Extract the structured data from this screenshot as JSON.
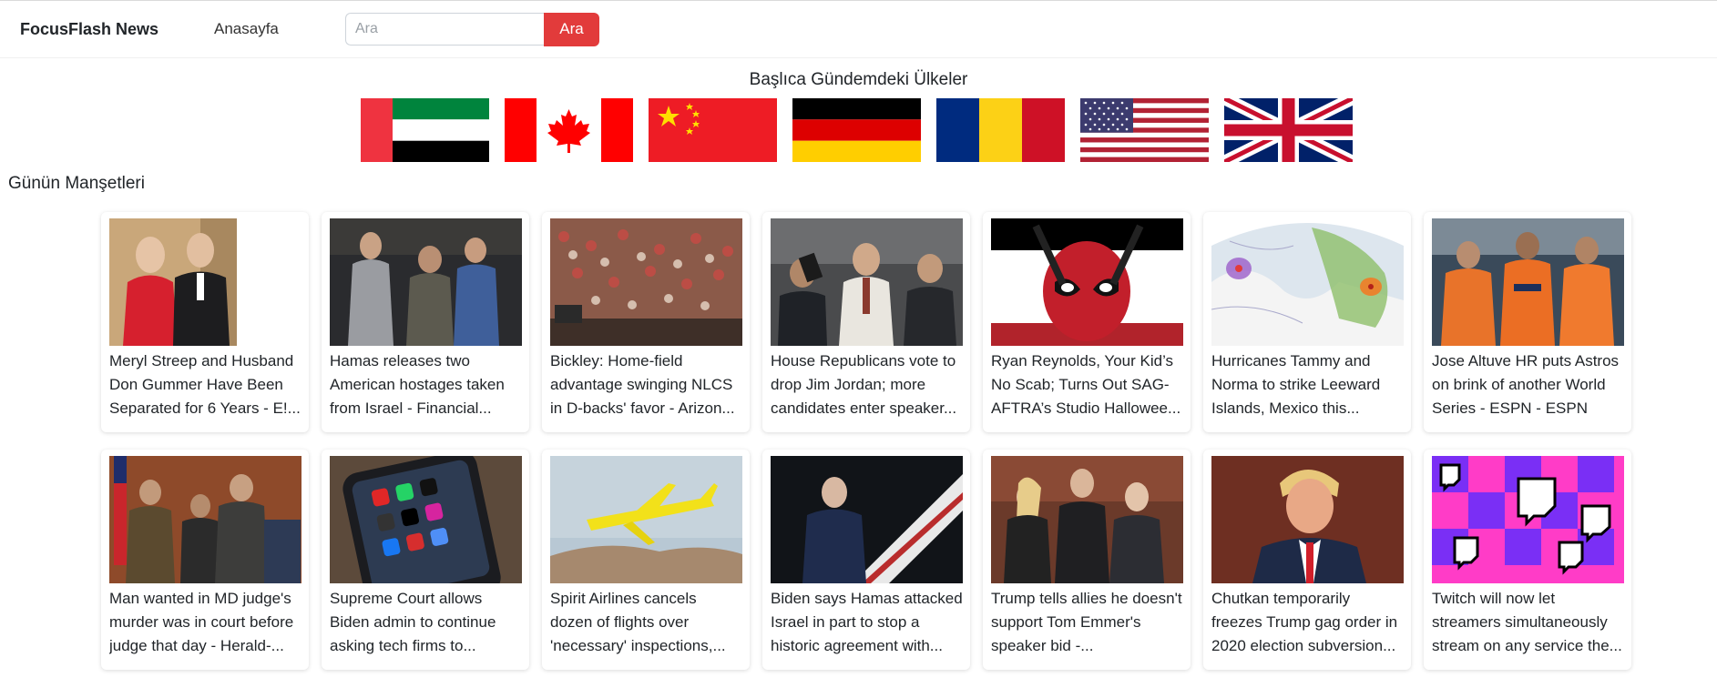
{
  "navbar": {
    "brand": "FocusFlash News",
    "home_link": "Anasayfa",
    "search_placeholder": "Ara",
    "search_button": "Ara",
    "accent_color": "#e23b3b"
  },
  "countries": {
    "title": "Başlıca Gündemdeki Ülkeler",
    "flags": [
      "uae-flag-icon",
      "canada-flag-icon",
      "china-flag-icon",
      "germany-flag-icon",
      "romania-flag-icon",
      "usa-flag-icon",
      "uk-flag-icon"
    ]
  },
  "headlines": {
    "title": "Günün Manşetleri",
    "row1": [
      "Meryl Streep and Husband Don Gummer Have Been Separated for 6 Years - E!...",
      "Hamas releases two American hostages taken from Israel - Financial...",
      "Bickley: Home-field advantage swinging NLCS in D-backs' favor - Arizon...",
      "House Republicans vote to drop Jim Jordan; more candidates enter speaker...",
      "Ryan Reynolds, Your Kid’s No Scab; Turns Out SAG-AFTRA’s Studio Hallowee...",
      "Hurricanes Tammy and Norma to strike Leeward Islands, Mexico this...",
      "Jose Altuve HR puts Astros on brink of another World Series - ESPN - ESPN"
    ],
    "row2": [
      "Man wanted in MD judge's murder was in court before judge that day - Herald-...",
      "Supreme Court allows Biden admin to continue asking tech firms to...",
      "Spirit Airlines cancels dozen of flights over 'necessary' inspections,...",
      "Biden says Hamas attacked Israel in part to stop a historic agreement with...",
      "Trump tells allies he doesn't support Tom Emmer's speaker bid -...",
      "Chutkan temporarily freezes Trump gag order in 2020 election subversion...",
      "Twitch will now let streamers simultaneously stream on any service the..."
    ]
  }
}
